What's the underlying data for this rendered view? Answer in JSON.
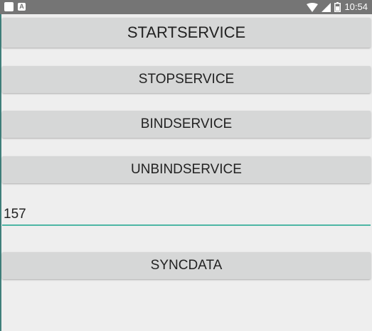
{
  "status_bar": {
    "time": "10:54",
    "left_icons": [
      "notification-square-icon",
      "a-badge-icon"
    ],
    "right_icons": [
      "wifi-icon",
      "signal-icon",
      "battery-icon"
    ],
    "a_badge": "A"
  },
  "buttons": {
    "start_service": "STARTSERVICE",
    "stop_service": "STOPSERVICE",
    "bind_service": "BINDSERVICE",
    "unbind_service": "UNBINDSERVICE",
    "sync_data": "SYNCDATA"
  },
  "data_input": {
    "value": "157",
    "accent_color": "#4db6a4"
  },
  "colors": {
    "background": "#eeeeee",
    "button": "#d6d7d7",
    "status_bar": "#757575"
  }
}
